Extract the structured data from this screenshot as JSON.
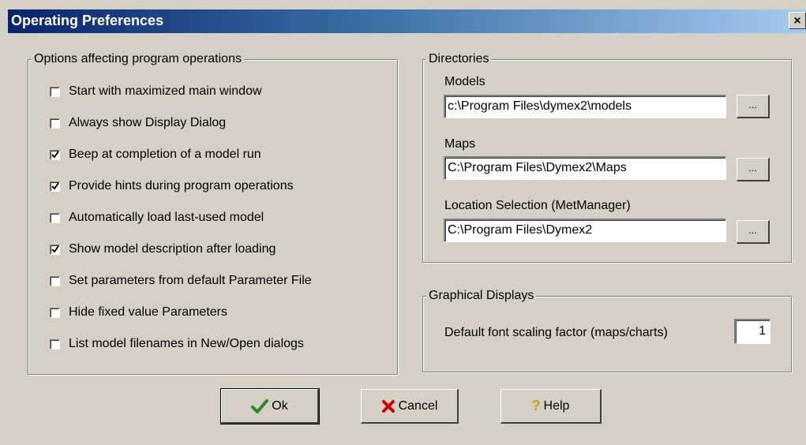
{
  "window": {
    "title": "Operating Preferences",
    "close_label": "×"
  },
  "options": {
    "legend": "Options affecting program operations",
    "items": [
      {
        "label": "Start with maximized main window",
        "checked": false
      },
      {
        "label": "Always show Display Dialog",
        "checked": false
      },
      {
        "label": "Beep at completion of a model run",
        "checked": true
      },
      {
        "label": "Provide hints during program operations",
        "checked": true
      },
      {
        "label": "Automatically load last-used model",
        "checked": false
      },
      {
        "label": "Show model description after loading",
        "checked": true
      },
      {
        "label": "Set parameters from default Parameter File",
        "checked": false
      },
      {
        "label": "Hide fixed value Parameters",
        "checked": false
      },
      {
        "label": "List model filenames in New/Open dialogs",
        "checked": false
      }
    ]
  },
  "directories": {
    "legend": "Directories",
    "models_label": "Models",
    "models_value": "c:\\Program Files\\dymex2\\models",
    "maps_label": "Maps",
    "maps_value": "C:\\Program Files\\Dymex2\\Maps",
    "location_label": "Location Selection (MetManager)",
    "location_value": "C:\\Program Files\\Dymex2",
    "browse_label": "..."
  },
  "graphical": {
    "legend": "Graphical Displays",
    "font_label": "Default font scaling factor (maps/charts)",
    "font_value": "1"
  },
  "buttons": {
    "ok": "Ok",
    "cancel": "Cancel",
    "help": "Help"
  },
  "icons": {
    "ok": "checkmark-icon",
    "cancel": "red-x-icon",
    "help": "question-mark-icon"
  },
  "colors": {
    "ok_icon": "#2a8a1e",
    "cancel_icon": "#cc0000",
    "help_icon": "#c8a000"
  }
}
